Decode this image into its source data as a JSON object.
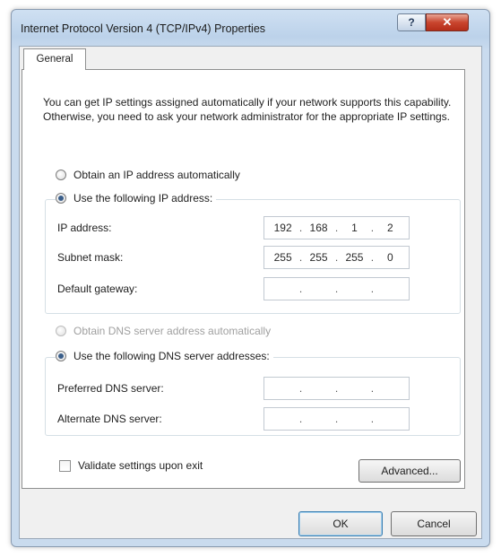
{
  "window": {
    "title": "Internet Protocol Version 4 (TCP/IPv4) Properties",
    "help_glyph": "?",
    "close_glyph": "✕"
  },
  "tabs": [
    {
      "label": "General"
    }
  ],
  "general": {
    "description": "You can get IP settings assigned automatically if your network supports this capability. Otherwise, you need to ask your network administrator for the appropriate IP settings.",
    "ip_mode": {
      "auto_label": "Obtain an IP address automatically",
      "manual_label": "Use the following IP address:",
      "selected": "manual"
    },
    "ip_fields": {
      "ip_address": {
        "label": "IP address:",
        "octets": [
          "192",
          "168",
          "1",
          "2"
        ]
      },
      "subnet_mask": {
        "label": "Subnet mask:",
        "octets": [
          "255",
          "255",
          "255",
          "0"
        ]
      },
      "default_gateway": {
        "label": "Default gateway:",
        "octets": [
          "",
          "",
          "",
          ""
        ]
      }
    },
    "dns_mode": {
      "auto_label": "Obtain DNS server address automatically",
      "manual_label": "Use the following DNS server addresses:",
      "selected": "manual"
    },
    "dns_fields": {
      "preferred": {
        "label": "Preferred DNS server:",
        "octets": [
          "",
          "",
          "",
          ""
        ]
      },
      "alternate": {
        "label": "Alternate DNS server:",
        "octets": [
          "",
          "",
          "",
          ""
        ]
      }
    },
    "validate_label": "Validate settings upon exit",
    "validate_checked": false,
    "advanced_label": "Advanced..."
  },
  "footer": {
    "ok_label": "OK",
    "cancel_label": "Cancel"
  },
  "icons": {
    "help": "help-icon",
    "close": "close-icon"
  },
  "colors": {
    "titlebar": "#bcd2ea",
    "close_button": "#c9452e",
    "radio_dot": "#3a5e8a",
    "default_button_border": "#3c7fb1"
  }
}
